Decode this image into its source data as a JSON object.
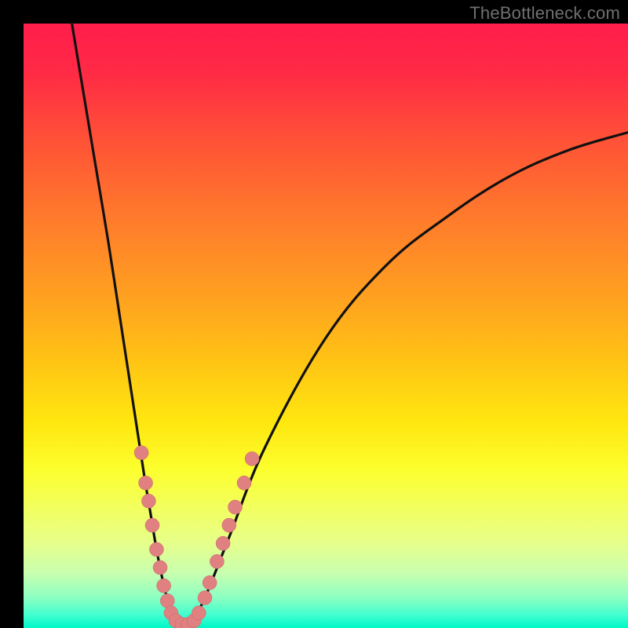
{
  "watermark": "TheBottleneck.com",
  "colors": {
    "frame": "#000000",
    "curve": "#111111",
    "marker_fill": "#e08080",
    "marker_stroke": "#c56a6a",
    "gradient_top": "#ff1d4c",
    "gradient_bottom": "#00f7c7"
  },
  "chart_data": {
    "type": "line",
    "title": "",
    "xlabel": "",
    "ylabel": "",
    "xlim": [
      0,
      100
    ],
    "ylim": [
      0,
      100
    ],
    "grid": false,
    "series": [
      {
        "name": "bottleneck-curve",
        "x": [
          8,
          10,
          12,
          14,
          16,
          18,
          20,
          21,
          22,
          23,
          24,
          25,
          26,
          27,
          28,
          30,
          34,
          40,
          50,
          60,
          70,
          80,
          90,
          100
        ],
        "y": [
          100,
          88,
          76,
          64,
          51,
          38,
          25,
          19,
          13,
          8,
          4,
          1.5,
          0.5,
          0.5,
          1.5,
          5,
          15,
          30,
          48,
          60,
          68,
          74.5,
          79,
          82
        ]
      }
    ],
    "markers": {
      "name": "highlighted-points",
      "points": [
        {
          "x": 19.5,
          "y": 29
        },
        {
          "x": 20.2,
          "y": 24
        },
        {
          "x": 20.7,
          "y": 21
        },
        {
          "x": 21.3,
          "y": 17
        },
        {
          "x": 22.0,
          "y": 13
        },
        {
          "x": 22.6,
          "y": 10
        },
        {
          "x": 23.2,
          "y": 7
        },
        {
          "x": 23.8,
          "y": 4.5
        },
        {
          "x": 24.4,
          "y": 2.5
        },
        {
          "x": 25.2,
          "y": 1.2
        },
        {
          "x": 26.2,
          "y": 0.6
        },
        {
          "x": 27.2,
          "y": 0.6
        },
        {
          "x": 28.2,
          "y": 1.2
        },
        {
          "x": 29.0,
          "y": 2.5
        },
        {
          "x": 30.0,
          "y": 5
        },
        {
          "x": 30.8,
          "y": 7.5
        },
        {
          "x": 32.0,
          "y": 11
        },
        {
          "x": 33.0,
          "y": 14
        },
        {
          "x": 34.0,
          "y": 17
        },
        {
          "x": 35.0,
          "y": 20
        },
        {
          "x": 36.5,
          "y": 24
        },
        {
          "x": 37.8,
          "y": 28
        }
      ]
    }
  }
}
